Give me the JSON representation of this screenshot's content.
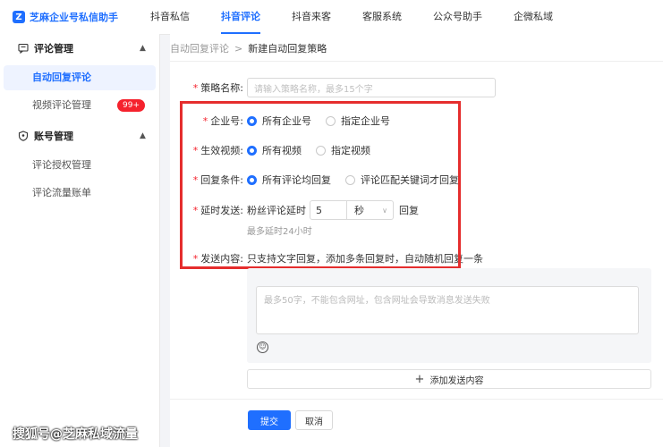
{
  "app": {
    "title": "芝麻企业号私信助手"
  },
  "topnav": [
    "抖音私信",
    "抖音评论",
    "抖音来客",
    "客服系统",
    "公众号助手",
    "企微私域"
  ],
  "sidebar": {
    "sections": [
      {
        "label": "评论管理",
        "items": [
          {
            "label": "自动回复评论"
          },
          {
            "label": "视频评论管理",
            "badge": "99+"
          }
        ]
      },
      {
        "label": "账号管理",
        "items": [
          {
            "label": "评论授权管理"
          },
          {
            "label": "评论流量账单"
          }
        ]
      }
    ]
  },
  "breadcrumb": {
    "parent": "自动回复评论",
    "separator": ">",
    "current": "新建自动回复策略"
  },
  "form": {
    "name": {
      "label": "策略名称:",
      "placeholder": "请输入策略名称，最多15个字"
    },
    "account": {
      "label": "企业号:",
      "options": [
        "所有企业号",
        "指定企业号"
      ]
    },
    "video": {
      "label": "生效视频:",
      "options": [
        "所有视频",
        "指定视频"
      ]
    },
    "condition": {
      "label": "回复条件:",
      "options": [
        "所有评论均回复",
        "评论匹配关键词才回复"
      ]
    },
    "delay": {
      "label": "延时发送:",
      "prefix": "粉丝评论延时",
      "value": "5",
      "unit": "秒",
      "suffix": "回复",
      "hint": "最多延时24小时"
    },
    "content": {
      "label": "发送内容:",
      "desc": "只支持文字回复，添加多条回复时，自动随机回复一条",
      "placeholder": "最多50字，不能包含网址，包含网址会导致消息发送失败",
      "add_label": "添加发送内容"
    }
  },
  "actions": {
    "submit": "提交",
    "cancel": "取消"
  },
  "watermark": "搜狐号@芝麻私域流量"
}
